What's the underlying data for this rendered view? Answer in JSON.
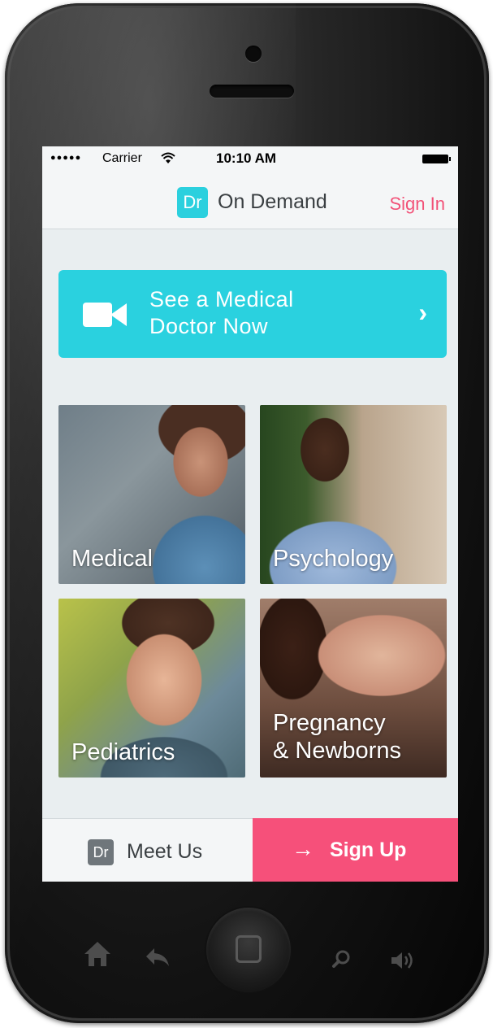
{
  "status_bar": {
    "carrier": "Carrier",
    "time": "10:10 AM"
  },
  "header": {
    "logo_text": "Dr",
    "title": "On Demand",
    "sign_in_label": "Sign In"
  },
  "cta": {
    "line1": "See a Medical",
    "line2": "Doctor Now",
    "icon": "video-camera-icon"
  },
  "categories": [
    {
      "label": "Medical"
    },
    {
      "label": "Psychology"
    },
    {
      "label": "Pediatrics"
    },
    {
      "label_line1": "Pregnancy",
      "label_line2": "& Newborns"
    }
  ],
  "footer": {
    "meet_logo": "Dr",
    "meet_label": "Meet Us",
    "signup_label": "Sign Up"
  },
  "colors": {
    "accent": "#2ad1df",
    "brand_pink": "#f6507a",
    "background": "#e9eef0"
  }
}
